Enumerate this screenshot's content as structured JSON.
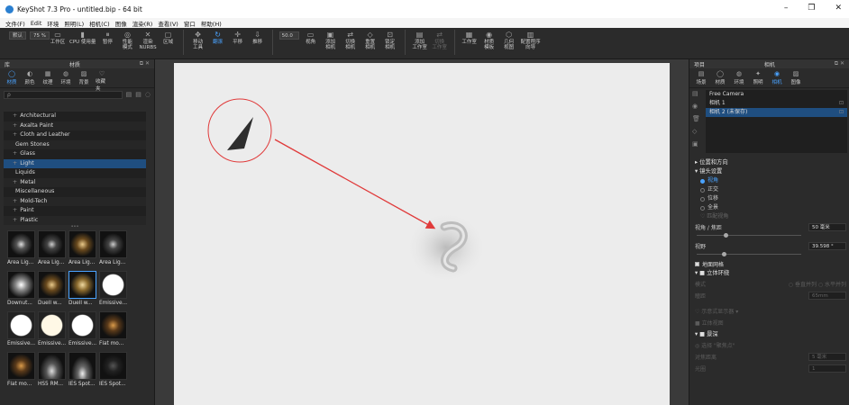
{
  "window": {
    "title": "KeyShot 7.3 Pro - untitled.bip - 64 bit",
    "controls": [
      "–",
      "❐",
      "✕"
    ]
  },
  "menu": [
    "文件(F)",
    "Edit",
    "环境",
    "照明(L)",
    "相机(C)",
    "图像",
    "渲染(R)",
    "查看(V)",
    "窗口",
    "帮助(H)"
  ],
  "toolbar": {
    "workspace_combo": "默认",
    "cpu_combo": "75 %",
    "zoom_value": "50.0",
    "buttons": [
      {
        "label": "工作区",
        "icon": "▭"
      },
      {
        "label": "CPU 使用量",
        "icon": "▮"
      },
      {
        "label": "暂停",
        "icon": "⏸"
      },
      {
        "label": "性能\n模式",
        "icon": "◎"
      },
      {
        "label": "渲染\nNURBS",
        "icon": "✕"
      },
      {
        "label": "区域",
        "icon": "▢"
      },
      {
        "label": "移动\n工具",
        "icon": "✥"
      },
      {
        "label": "翻滚",
        "icon": "↻",
        "active": true
      },
      {
        "label": "平移",
        "icon": "✛"
      },
      {
        "label": "推移",
        "icon": "⇩"
      },
      {
        "label": "视角",
        "icon": "▭"
      },
      {
        "label": "添加\n相机",
        "icon": "▣"
      },
      {
        "label": "切换\n相机",
        "icon": "⇄"
      },
      {
        "label": "重置\n相机",
        "icon": "◇"
      },
      {
        "label": "锁定\n相机",
        "icon": "⊡"
      },
      {
        "label": "添加\n工作室",
        "icon": "▤"
      },
      {
        "label": "切换\n工作室",
        "icon": "⇄",
        "dim": true
      },
      {
        "label": "工作室",
        "icon": "▦"
      },
      {
        "label": "材质\n模板",
        "icon": "◉"
      },
      {
        "label": "几何\n视图",
        "icon": "⬡"
      },
      {
        "label": "配置程序\n向导",
        "icon": "▥"
      }
    ]
  },
  "library": {
    "header": "库",
    "title": "材质",
    "tabs": [
      {
        "label": "材质",
        "icon": "◯",
        "active": true
      },
      {
        "label": "颜色",
        "icon": "◐"
      },
      {
        "label": "纹理",
        "icon": "▦"
      },
      {
        "label": "环境",
        "icon": "◍"
      },
      {
        "label": "背景",
        "icon": "▨"
      },
      {
        "label": "收藏夹",
        "icon": "♡"
      }
    ],
    "search_placeholder": "ρ",
    "tree": [
      {
        "label": "Architectural",
        "plus": true
      },
      {
        "label": "Axalta Paint",
        "plus": true
      },
      {
        "label": "Cloth and Leather",
        "plus": true
      },
      {
        "label": "Gem Stones",
        "plus": false
      },
      {
        "label": "Glass",
        "plus": true
      },
      {
        "label": "Light",
        "plus": true,
        "selected": true
      },
      {
        "label": "Liquids",
        "plus": false
      },
      {
        "label": "Metal",
        "plus": true
      },
      {
        "label": "Miscellaneous",
        "plus": false
      },
      {
        "label": "Mold-Tech",
        "plus": true
      },
      {
        "label": "Paint",
        "plus": true
      },
      {
        "label": "Plastic",
        "plus": true
      }
    ],
    "thumbnails": [
      "Area Lig...",
      "Area Lig...",
      "Area Lig...",
      "Area Lig...",
      "Downut...",
      "Duell w...",
      "Duell w...",
      "Emissive...",
      "Emissive...",
      "Emissive...",
      "Emissive...",
      "Flat mo...",
      "Flat mo...",
      "HS5 RM...",
      "IES Spot...",
      "IES Spot..."
    ]
  },
  "project": {
    "header": "项目",
    "title": "相机",
    "tabs": [
      {
        "label": "场景",
        "icon": "▤"
      },
      {
        "label": "材质",
        "icon": "◯"
      },
      {
        "label": "环境",
        "icon": "◍"
      },
      {
        "label": "照明",
        "icon": "✦"
      },
      {
        "label": "相机",
        "icon": "◉",
        "active": true
      },
      {
        "label": "图像",
        "icon": "▨"
      }
    ],
    "cameras": [
      {
        "label": "Free Camera",
        "selected": false
      },
      {
        "label": "相机 1",
        "selected": false
      },
      {
        "label": "相机 2 (未保存)",
        "selected": true
      }
    ],
    "position_section": "▸ 位置和方向",
    "lens_section": "▾ 镜头设置",
    "lens_options": [
      {
        "label": "视角",
        "on": true
      },
      {
        "label": "正交",
        "on": false
      },
      {
        "label": "位移",
        "on": false
      },
      {
        "label": "全景",
        "on": false
      }
    ],
    "match_perspective": "♡ 匹配视角",
    "focal_label": "视角 / 焦距",
    "focal_value": "50 毫米",
    "fov_label": "视野",
    "fov_value": "39.598 °",
    "ground_grid": "地面网格",
    "stereo_section": "▾ ■ 立体环绕",
    "stereo_mode_label": "模式",
    "stereo_mode_options": "○ 垂直并列   ○ 水平并列",
    "stereo_offset_label": "瞳距",
    "stereo_offset_value": "65mm",
    "stereo_display": "♡ 示意式显示器 ▾",
    "stereo_view": "■ 立体视图",
    "dof_section": "▾ ■ 景深",
    "dof_pick": "◎ 选择 \"聚焦点\"",
    "dof_distance_label": "对焦距离",
    "dof_distance_value": "5 毫米",
    "dof_aperture_label": "光圈",
    "dof_aperture_value": "1"
  },
  "colors": {
    "accent": "#4aa3ff",
    "annotation": "#e03a3a",
    "selection": "#1f4e80"
  }
}
